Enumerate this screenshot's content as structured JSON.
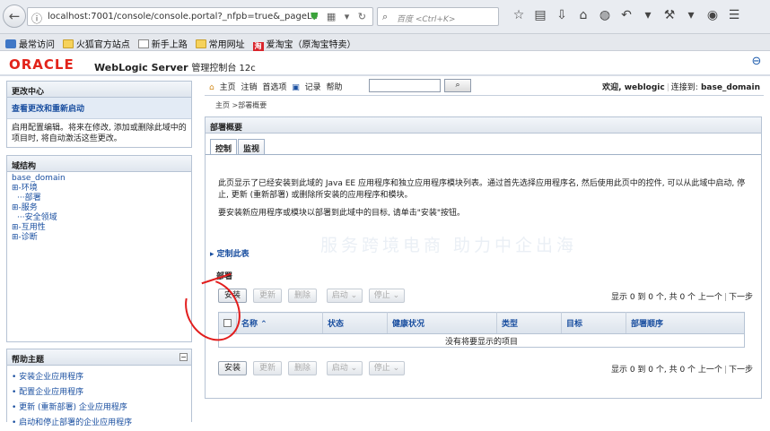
{
  "browser": {
    "url": "localhost:7001/console/console.portal?_nfpb=true&_pageLa",
    "search_placeholder": "百度 <Ctrl+K>"
  },
  "bookmarks": [
    "最常访问",
    "火狐官方站点",
    "新手上路",
    "常用网址",
    "爱淘宝（原淘宝特卖）"
  ],
  "header": {
    "brand": "ORACLE",
    "product": "WebLogic Server",
    "subtitle": "管理控制台 12c"
  },
  "change_center": {
    "title": "更改中心",
    "link": "查看更改和重新启动",
    "text": "启用配置编辑。将来在修改, 添加或删除此域中的项目时, 将自动激活这些更改。"
  },
  "domain_structure": {
    "title": "域结构",
    "root": "base_domain",
    "items": [
      "⊞-环境",
      "···部署",
      "⊞-服务",
      "···安全领域",
      "⊞-互用性",
      "⊞-诊断"
    ]
  },
  "help": {
    "title": "帮助主题",
    "items": [
      "安装企业应用程序",
      "配置企业应用程序",
      "更新 (重新部署) 企业应用程序",
      "启动和停止部署的企业应用程序"
    ]
  },
  "toolbar": {
    "links": [
      "主页",
      "注销",
      "首选项",
      "记录",
      "帮助"
    ],
    "welcome": "欢迎, weblogic",
    "connected_label": "连接到:",
    "domain": "base_domain"
  },
  "breadcrumb": "主页 >部署概要",
  "main": {
    "title": "部署概要",
    "tabs": [
      "控制",
      "监视"
    ],
    "desc1": "此页显示了已经安装到此域的 Java EE 应用程序和独立应用程序模块列表。通过首先选择应用程序名, 然后使用此页中的控件, 可以从此域中启动, 停止, 更新 (重新部署) 或删除所安装的应用程序和模块。",
    "desc2": "要安装新应用程序或模块以部署到此域中的目标, 请单击\"安装\"按钮。",
    "customize": "定制此表",
    "watermark": "服务跨境电商 助力中企出海",
    "section": "部署",
    "buttons": [
      "安装",
      "更新",
      "删除",
      "启动",
      "停止"
    ],
    "pager": "显示 0 到 0 个, 共 0 个",
    "prev": "上一个",
    "next": "下一步",
    "columns": [
      "名称",
      "状态",
      "健康状况",
      "类型",
      "目标",
      "部署顺序"
    ],
    "empty": "没有将要显示的项目"
  }
}
